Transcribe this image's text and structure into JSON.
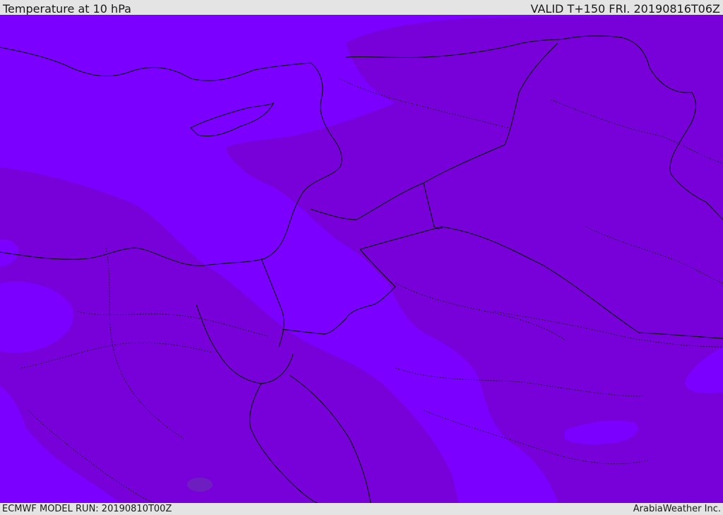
{
  "header": {
    "title": "Temperature at 10 hPa",
    "valid_time": "VALID T+150 FRI. 20190816T06Z"
  },
  "footer": {
    "model_run": "ECMWF MODEL RUN: 20190810T00Z",
    "credit": "ArabiaWeather Inc."
  },
  "colors": {
    "warm_band": "#7b00ff",
    "cool_band": "#7800d8",
    "cold_spot": "#6e1ec0",
    "border_line": "#000000",
    "bar_background": "#e4e4e4"
  }
}
